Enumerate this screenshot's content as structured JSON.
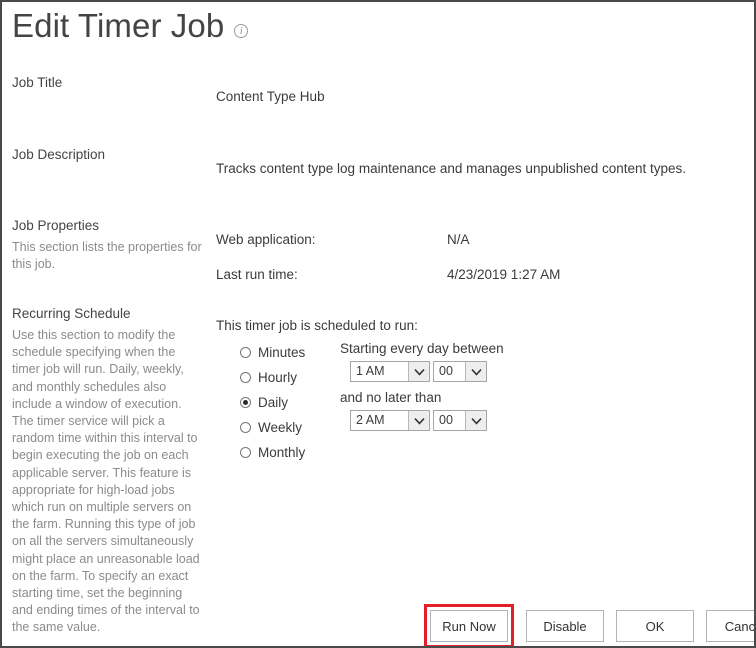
{
  "header": {
    "title": "Edit Timer Job",
    "info_icon": "info-icon",
    "info_icon_glyph": "i"
  },
  "sections": {
    "job_title": {
      "label": "Job Title",
      "value": "Content Type Hub"
    },
    "job_description": {
      "label": "Job Description",
      "value": "Tracks content type log maintenance and manages unpublished content types."
    },
    "job_properties": {
      "label": "Job Properties",
      "description": "This section lists the properties for this job.",
      "rows": [
        {
          "label": "Web application:",
          "value": "N/A"
        },
        {
          "label": "Last run time:",
          "value": "4/23/2019 1:27 AM"
        }
      ]
    },
    "recurring_schedule": {
      "label": "Recurring Schedule",
      "description": "Use this section to modify the schedule specifying when the timer job will run. Daily, weekly, and monthly schedules also include a window of execution. The timer service will pick a random time within this interval to begin executing the job on each applicable server. This feature is appropriate for high-load jobs which run on multiple servers on the farm. Running this type of job on all the servers simultaneously might place an unreasonable load on the farm. To specify an exact starting time, set the beginning and ending times of the interval to the same value.",
      "schedule_prompt": "This timer job is scheduled to run:",
      "options": [
        {
          "label": "Minutes",
          "selected": false
        },
        {
          "label": "Hourly",
          "selected": false
        },
        {
          "label": "Daily",
          "selected": true
        },
        {
          "label": "Weekly",
          "selected": false
        },
        {
          "label": "Monthly",
          "selected": false
        }
      ],
      "start_label": "Starting every day between",
      "start_hour": "1 AM",
      "start_minute": "00",
      "end_label": "and no later than",
      "end_hour": "2 AM",
      "end_minute": "00",
      "dropdown_icon": "chevron-down-icon"
    }
  },
  "buttons": {
    "run_now": "Run Now",
    "disable": "Disable",
    "ok": "OK",
    "cancel": "Cancel"
  },
  "colors": {
    "highlight": "#e22027",
    "text": "#3b3b3b",
    "muted_text": "#8b8b8b",
    "border": "#b4b4b4"
  }
}
